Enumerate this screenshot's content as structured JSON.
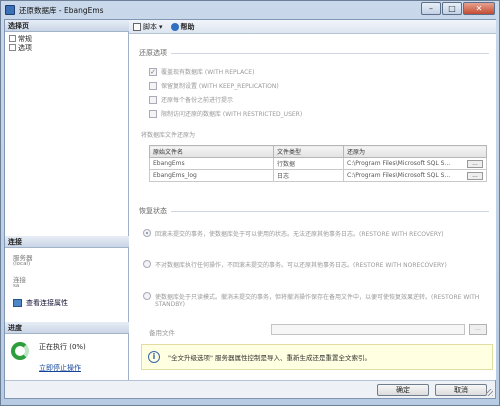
{
  "window": {
    "title": "还原数据库 - EbangEms"
  },
  "sidebar": {
    "select_page_header": "选择页",
    "pages": [
      {
        "label": "常规"
      },
      {
        "label": "选项"
      }
    ],
    "connection_header": "连接",
    "server_label": "服务器",
    "server_value": "(local)",
    "connection_label": "连接",
    "connection_value": "sa",
    "view_connection_props": "查看连接属性",
    "progress_header": "进度",
    "progress_status": "正在执行 (0%)",
    "stop_link": "立即停止操作"
  },
  "toolbar": {
    "script_label": "脚本",
    "help_label": "帮助"
  },
  "restore_options": {
    "title": "还原选项",
    "checks": [
      {
        "label": "覆盖现有数据库 (WITH REPLACE)",
        "checked": true
      },
      {
        "label": "保留复制设置 (WITH KEEP_REPLICATION)",
        "checked": false
      },
      {
        "label": "还原每个备份之前进行提示",
        "checked": false
      },
      {
        "label": "限制访问还原的数据库 (WITH RESTRICTED_USER)",
        "checked": false
      }
    ]
  },
  "files": {
    "caption": "将数据库文件还原为",
    "columns": [
      "原始文件名",
      "文件类型",
      "还原为"
    ],
    "rows": [
      {
        "name": "EbangEms",
        "type": "行数据",
        "path": "C:\\Program Files\\Microsoft SQL S..."
      },
      {
        "name": "EbangEms_log",
        "type": "日志",
        "path": "C:\\Program Files\\Microsoft SQL S..."
      }
    ],
    "browse_label": "..."
  },
  "recovery": {
    "title": "恢复状态",
    "options": [
      {
        "label": "回滚未提交的事务，使数据库处于可以使用的状态。无法还原其他事务日志。(RESTORE WITH RECOVERY)",
        "selected": true
      },
      {
        "label": "不对数据库执行任何操作，不回滚未提交的事务。可以还原其他事务日志。(RESTORE WITH NORECOVERY)",
        "selected": false
      },
      {
        "label": "使数据库处于只读模式。撤消未提交的事务，但将撤消操作保存在备用文件中，以便可使恢复效果逆转。(RESTORE WITH STANDBY)",
        "selected": false
      }
    ],
    "standby_file_label": "备用文件",
    "browse_label": "..."
  },
  "info": {
    "message": "\"全文升级选项\" 服务器属性控制是导入、重新生成还是重置全文索引。"
  },
  "buttons": {
    "ok": "确定",
    "cancel": "取消"
  }
}
